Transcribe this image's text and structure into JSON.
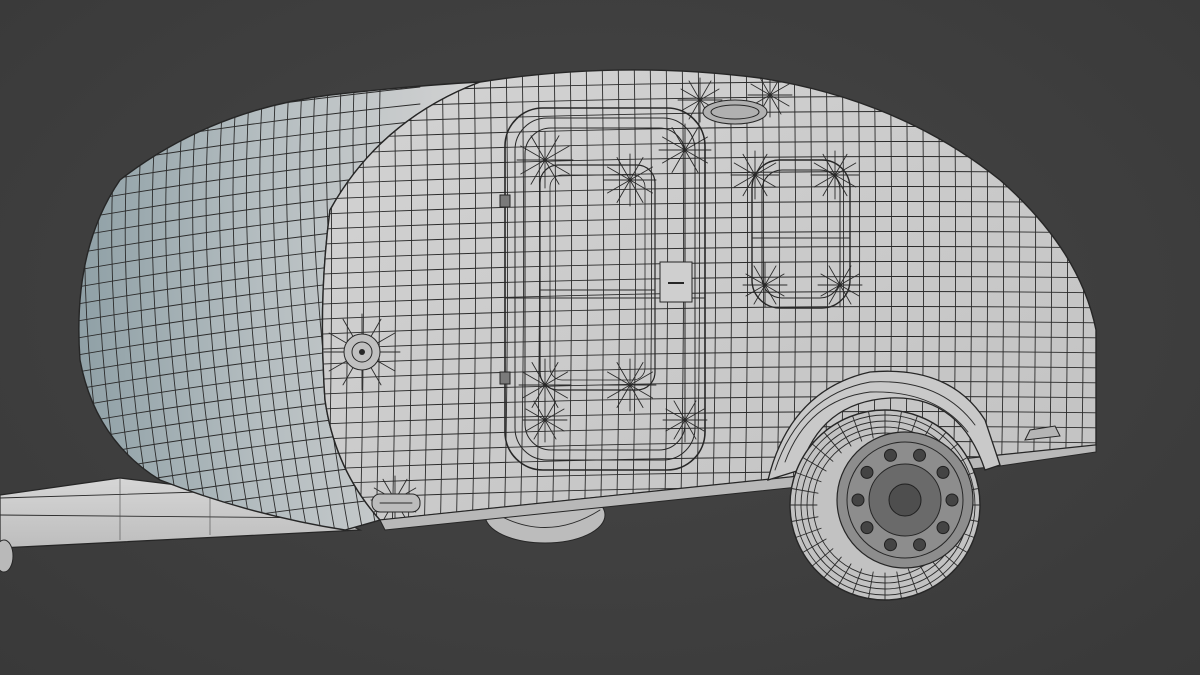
{
  "scene": {
    "subject": "teardrop-camper-trailer-wireframe",
    "background_color": "#3f3f3f",
    "surface_color": "#c7c7c7",
    "surface_shadow_color": "#86959b",
    "wire_color": "#2b2b2b",
    "tire_color": "#bdbdbd",
    "hub_color": "#5a5a5a"
  }
}
